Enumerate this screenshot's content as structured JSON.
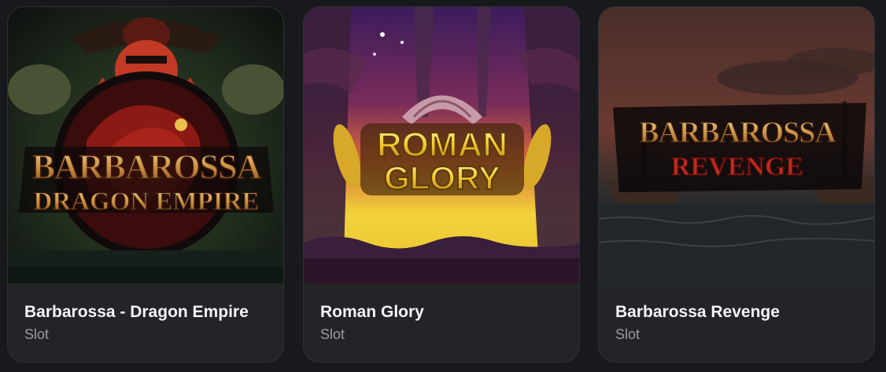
{
  "games": [
    {
      "title": "Barbarossa - Dragon Empire",
      "type": "Slot",
      "art_text": [
        "BARBAROSSA",
        "DRAGON EMPIRE"
      ]
    },
    {
      "title": "Roman Glory",
      "type": "Slot",
      "art_text": [
        "ROMAN",
        "GLORY"
      ]
    },
    {
      "title": "Barbarossa Revenge",
      "type": "Slot",
      "art_text": [
        "BARBAROSSA",
        "REVENGE"
      ]
    }
  ]
}
